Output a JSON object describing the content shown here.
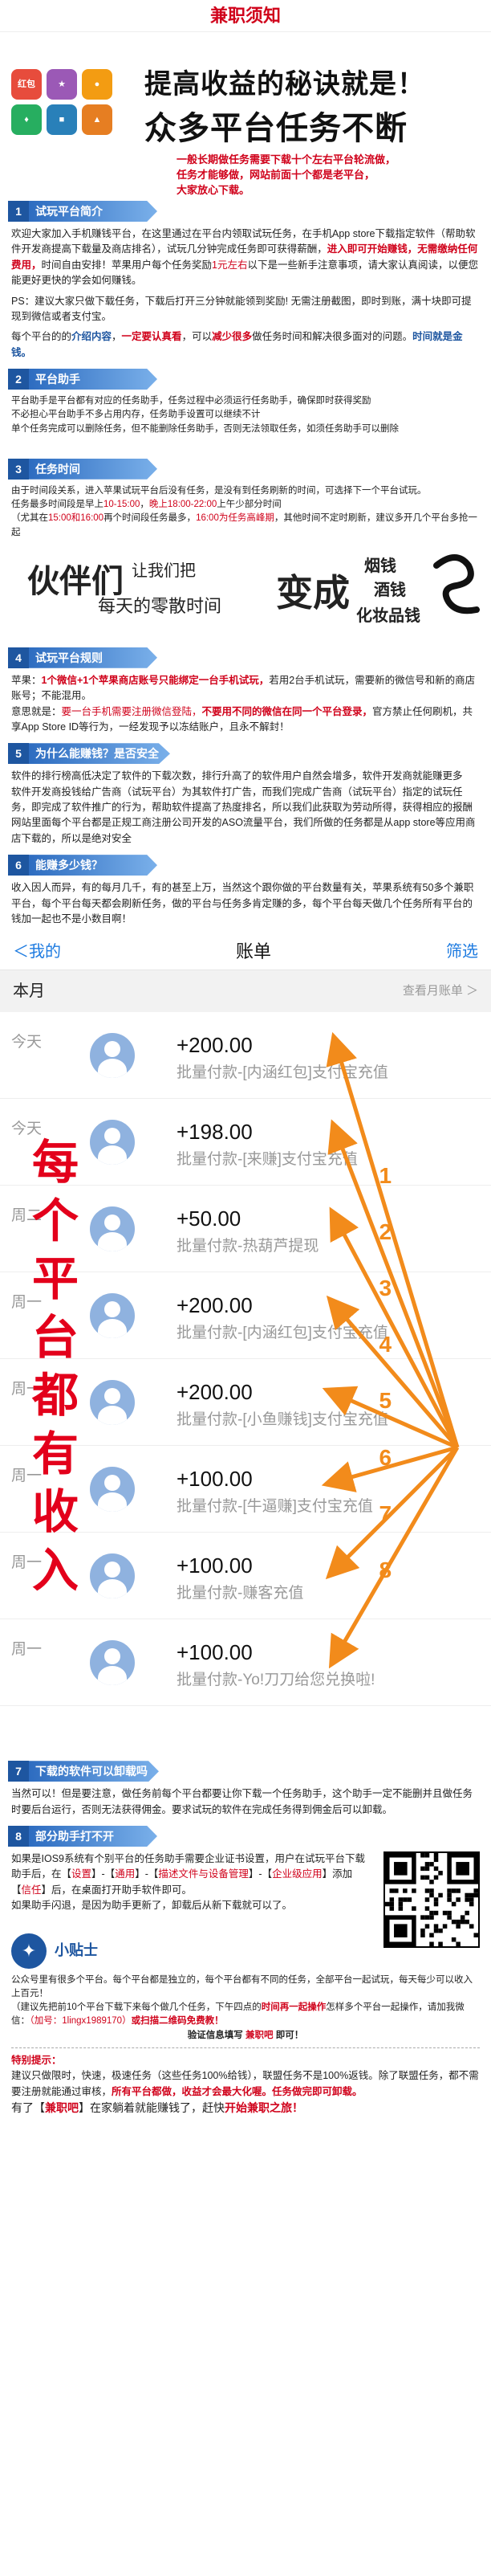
{
  "header": {
    "title": "兼职须知"
  },
  "hero": {
    "icon_labels": [
      "红包",
      "",
      "",
      "",
      "",
      ""
    ],
    "headline_1": "提高收益的秘诀就是！",
    "headline_2": "众多平台任务不断",
    "red_lines": [
      "一般长期做任务需要下载十个左右平台轮流做，",
      "任务才能够做，网站前面十个都是老平台，",
      "大家放心下载。"
    ]
  },
  "sections": [
    {
      "num": "1",
      "title": "试玩平台简介"
    },
    {
      "num": "2",
      "title": "平台助手"
    },
    {
      "num": "3",
      "title": "任务时间"
    },
    {
      "num": "4",
      "title": "试玩平台规则"
    },
    {
      "num": "5",
      "title": "为什么能赚钱？是否安全"
    },
    {
      "num": "6",
      "title": "能赚多少钱？"
    },
    {
      "num": "7",
      "title": "下载的软件可以卸载吗"
    },
    {
      "num": "8",
      "title": "部分助手打不开"
    }
  ],
  "s1": {
    "p1a": "欢迎大家加入手机赚钱平台，在这里通过在平台内领取试玩任务，在手机App store下载指定软件（帮助软件开发商提高下载量及商店排名），试玩几分钟完成任务即可获得薪酬，",
    "p1b": "进入即可开始赚钱，无需缴纳任何费用，",
    "p1c": "时间自由安排！苹果用户每个任务奖励",
    "p1d": "1元左右",
    "p1e": "以下是一些新手注意事项，请大家认真阅读，以便您能更好更快的学会如何赚钱。",
    "p2": "PS：建议大家只做下载任务，下载后打开三分钟就能领到奖励! 无需注册截图，即时到账，满十块即可提现到微信或者支付宝。",
    "p3a": "每个平台的的",
    "p3b": "介绍内容",
    "p3c": "，",
    "p3d": "一定要认真看",
    "p3e": "，可以",
    "p3f": "减少很多",
    "p3g": "做任务时间和解决很多面对的问题。",
    "p3h": "时间就是金钱。"
  },
  "s2": {
    "lines": [
      "平台助手是平台都有对应的任务助手，任务过程中必须运行任务助手，确保即时获得奖励",
      "不必担心平台助手不多占用内存，任务助手设置可以继续不计",
      "单个任务完成可以删除任务，但不能删除任务助手，否则无法领取任务，如须任务助手可以删除"
    ]
  },
  "s3": {
    "line1": "由于时间段关系，进入苹果试玩平台后没有任务，是没有到任务刷新的时间，可选择下一个平台试玩。",
    "line2a": "任务最多时间段是早上",
    "line2b": "10-15:00",
    "line2c": "，",
    "line2d": "晚上18:00-22:00",
    "line2e": "上午少部分时间",
    "line3a": "（尤其在",
    "line3b": "15:00和16:00",
    "line3c": "再个时间段任务最多，",
    "line3d": "16:00为任务高峰期",
    "line3e": "，其他时间不定时刷新，建议多开几个平台多抢一起"
  },
  "slogan": {
    "s1": "伙伴们",
    "s2": "让我们把",
    "s3": "每天的零散时间",
    "s4": "变成",
    "s5": "烟钱",
    "s6": "酒钱",
    "s7": "化妆品钱"
  },
  "s4": {
    "l1a": "苹果：",
    "l1b": "1个微信+1个苹果商店账号只能绑定一台手机试玩，",
    "l1c": "若用2台手机试玩，需要新的微信号和新的商店账号；不能混用。",
    "l2a": "意思就是：",
    "l2b": "要一台手机需要注册微信登陆，",
    "l2c": "不要用不同的微信在同一个平台登录，",
    "l2d": "官方禁止任何刷机，共享App Store ID等行为，一经发现予以冻结账户，且永不解封！"
  },
  "s5": {
    "l1": "软件的排行榜高低决定了软件的下载次数，排行升高了的软件用户自然会增多，软件开发商就能赚更多",
    "l2": "软件开发商投钱给广告商（试玩平台）为其软件打广告，而我们完成广告商（试玩平台）指定的试玩任务，即完成了软件推广的行为，帮助软件提高了热度排名，所以我们此获取为劳动所得，获得相应的报酬",
    "l3a": "网站",
    "l3b": "里面每个平台都是正规工商注册公司开发的ASO流量平台，我们所做的任务都是从app store等应用商店下载的，所以是绝对安全"
  },
  "s6": {
    "text": "收入因人而异，有的每月几千，有的甚至上万，当然这个跟你做的平台数量有关，苹果系统有50多个兼职平台，每个平台每天都会刷新任务，做的平台与任务多肯定赚的多，每个平台每天做几个任务所有平台的钱加一起也不是小数目啊！"
  },
  "bill": {
    "back_label": "＜我的",
    "title": "账单",
    "filter_label": "筛选",
    "month_label": "本月",
    "month_right": "查看月账单 ＞",
    "vertical_text": [
      "每",
      "个",
      "平",
      "台",
      "都",
      "有",
      "收",
      "入"
    ],
    "rows": [
      {
        "day": "今天",
        "amount": "+200.00",
        "desc": "批量付款-[内涵红包]支付宝充值"
      },
      {
        "day": "今天",
        "amount": "+198.00",
        "desc": "批量付款-[来赚]支付宝充值"
      },
      {
        "day": "周二",
        "amount": "+50.00",
        "desc": "批量付款-热葫芦提现"
      },
      {
        "day": "周一",
        "amount": "+200.00",
        "desc": "批量付款-[内涵红包]支付宝充值"
      },
      {
        "day": "周一",
        "amount": "+200.00",
        "desc": "批量付款-[小鱼赚钱]支付宝充值"
      },
      {
        "day": "周一",
        "amount": "+100.00",
        "desc": "批量付款-[牛逼赚]支付宝充值"
      },
      {
        "day": "周一",
        "amount": "+100.00",
        "desc": "批量付款-赚客充值"
      },
      {
        "day": "周一",
        "amount": "+100.00",
        "desc": "批量付款-Yo!刀刀给您兑换啦!"
      }
    ],
    "arrow_numbers": [
      "1",
      "2",
      "3",
      "4",
      "5",
      "6",
      "7",
      "8"
    ]
  },
  "s7": {
    "text": "当然可以！但是要注意，做任务前每个平台都要让你下载一个任务助手，这个助手一定不能删并且做任务时要后台运行，否则无法获得佣金。要求试玩的软件在完成任务得到佣金后可以卸载。"
  },
  "s8": {
    "l1a": "如果是IOS9系统有个别平台的任务助手需要企业证书设置，用户在试玩平台下载助手后，在【",
    "l1b": "设置",
    "l1c": "】-【",
    "l1d": "通用",
    "l1e": "】-【",
    "l1f": "描述文件与设备管理",
    "l1g": "】-【",
    "l1h": "企业级应用",
    "l1i": "】添加【",
    "l1j": "信任",
    "l1k": "】后，在桌面打开助手软件即可。",
    "l2": "如果助手闪退，是因为助手更新了，卸载后从新下载就可以了。"
  },
  "tip": {
    "title": "小贴士",
    "l1": "公众号里有很多个平台。每个平台都是独立的，每个平台都有不同的任务，全部平台一起试玩，每天每少可以收入上百元！",
    "l2a": "（建议先把前10个平台下载下来每个做几个任务，下午四点的",
    "l2b": "时间再一起操作",
    "l2c": "怎样多个平台一起操作，请加我微信：",
    "l2d": "（加号：1lingx1989170）",
    "l2e": "或扫描二维码免费教！",
    "l3a": "验证信息填写",
    "l3b": "兼职吧",
    "l3c": "即可！"
  },
  "special": {
    "title": "特别提示：",
    "l1": "建议只做限时，快速，极速任务（这些任务100%给钱），联盟任务不是100%返钱。除了联盟任务，都不需要注册就能通过审核，",
    "l1b": "所有平台都做，收益才会最大化喔。任务做完即可卸载。",
    "l2a": "有了【",
    "l2b": "兼职吧",
    "l2c": "】在家躺着就能赚钱了，赶快",
    "l2d": "开始兼职之旅！"
  },
  "colors": {
    "accent_red": "#d0021b",
    "accent_blue": "#1e56a0",
    "arrow_orange": "#f28b1b"
  }
}
